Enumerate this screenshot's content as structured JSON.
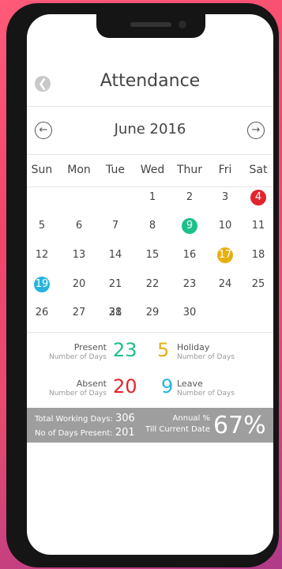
{
  "header": {
    "title": "Attendance"
  },
  "calendar": {
    "month": "June 2016",
    "weekdays": [
      "Sun",
      "Mon",
      "Tue",
      "Wed",
      "Thur",
      "Fri",
      "Sat"
    ],
    "marked_days": [
      {
        "day": 4,
        "status": "absent",
        "color": "#e3242b"
      },
      {
        "day": 9,
        "status": "present",
        "color": "#1dbf8b"
      },
      {
        "day": 17,
        "status": "holiday",
        "color": "#e6b012"
      },
      {
        "day": 19,
        "status": "leave",
        "color": "#27b4dc"
      }
    ]
  },
  "summary": {
    "present": {
      "label": "Present",
      "sub": "Number of Days",
      "value": "23",
      "color": "#1dbf8b"
    },
    "holiday": {
      "label": "Holiday",
      "sub": "Number of Days",
      "value": "5",
      "color": "#e6b012"
    },
    "absent": {
      "label": "Absent",
      "sub": "Number of Days",
      "value": "20",
      "color": "#e3242b"
    },
    "leave": {
      "label": "Leave",
      "sub": "Number of Days",
      "value": "9",
      "color": "#27b4dc"
    }
  },
  "footer": {
    "total_label": "Total Working Days:",
    "total_value": "306",
    "present_label": "No of Days Present:",
    "present_value": "201",
    "annual_label": "Annual %",
    "till_label": "Till Current Date",
    "percent": "67%"
  },
  "icons": {
    "back": "back-arrow-icon",
    "prev": "left-arrow-icon",
    "next": "right-arrow-icon"
  }
}
